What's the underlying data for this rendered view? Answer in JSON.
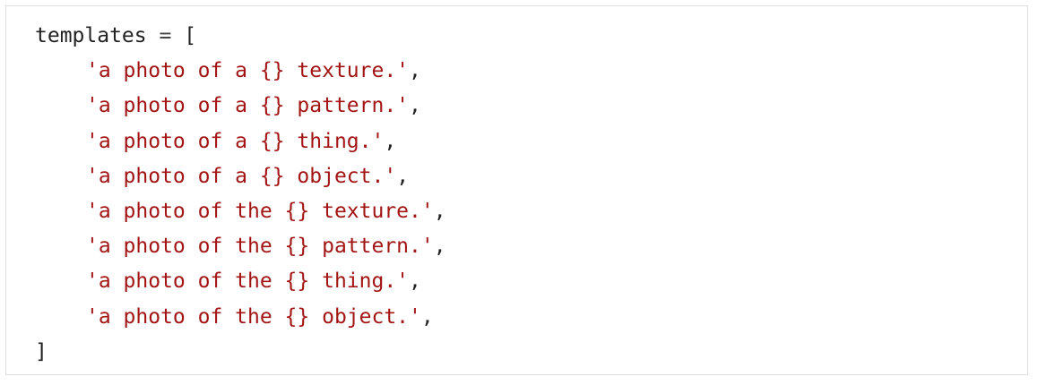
{
  "code": {
    "variable": "templates",
    "operator": "=",
    "open_bracket": "[",
    "close_bracket": "]",
    "entries": [
      "'a photo of a {} texture.'",
      "'a photo of a {} pattern.'",
      "'a photo of a {} thing.'",
      "'a photo of a {} object.'",
      "'a photo of the {} texture.'",
      "'a photo of the {} pattern.'",
      "'a photo of the {} thing.'",
      "'a photo of the {} object.'"
    ],
    "separator": ","
  },
  "colors": {
    "string": "#a31515",
    "text": "#222222",
    "border": "#e0e0e0"
  }
}
